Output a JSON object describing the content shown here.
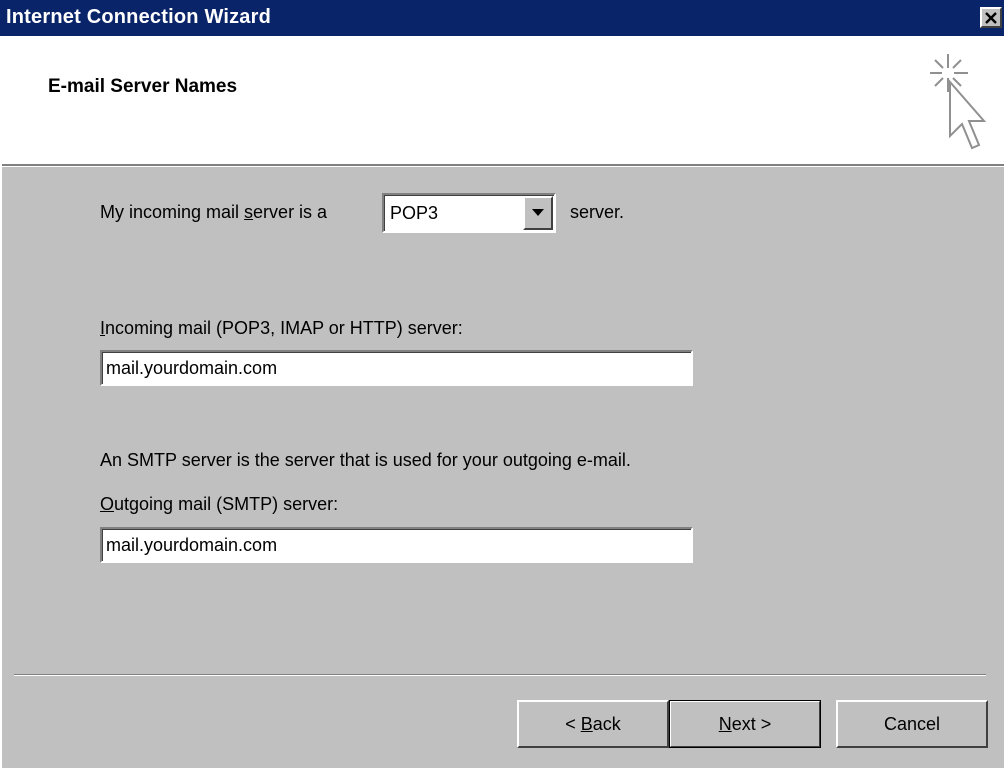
{
  "window": {
    "title": "Internet Connection Wizard",
    "close_glyph": "✕"
  },
  "header": {
    "heading": "E-mail Server Names",
    "icon": "wizard-cursor-icon"
  },
  "incoming_type": {
    "label_pre": "My incoming mail ",
    "label_accel": "s",
    "label_post": "erver is a",
    "selected": "POP3",
    "suffix": "server."
  },
  "incoming_server": {
    "label_accel": "I",
    "label_rest": "ncoming mail (POP3, IMAP or HTTP) server:",
    "value": "mail.yourdomain.com"
  },
  "smtp_note": "An SMTP server is the server that is used for your outgoing e-mail.",
  "outgoing_server": {
    "label_accel": "O",
    "label_rest": "utgoing mail (SMTP) server:",
    "value": "mail.yourdomain.com"
  },
  "buttons": {
    "back_pre": "< ",
    "back_accel": "B",
    "back_post": "ack",
    "next_accel": "N",
    "next_post": "ext >",
    "cancel": "Cancel"
  },
  "colors": {
    "titlebar": "#0a246a",
    "dialog": "#c0c0c0",
    "header_bg": "#ffffff"
  }
}
